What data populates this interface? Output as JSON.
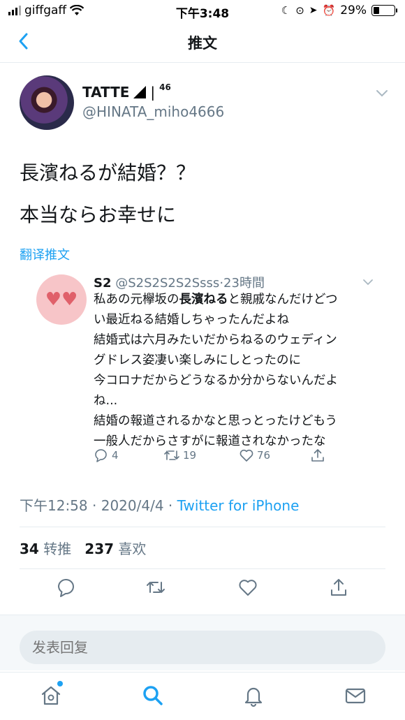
{
  "status_bar": {
    "carrier": "giffgaff",
    "time": "下午3:48",
    "battery": "29%",
    "battery_level": 0.29
  },
  "nav": {
    "title": "推文"
  },
  "tweet": {
    "author_name": "TATTE",
    "author_badge": "46",
    "author_handle": "@HINATA_miho4666",
    "lines": [
      "長濱ねるが結婚？？",
      "本当ならお幸せに"
    ],
    "translate_label": "翻译推文",
    "timestamp": "下午12:58",
    "date": "2020/4/4",
    "source": "Twitter for iPhone",
    "retweet_count": "34",
    "retweet_label": "转推",
    "like_count": "237",
    "like_label": "喜欢"
  },
  "quoted": {
    "name": "S2",
    "handle": "@S2S2S2S2Ssss",
    "time": "23時間",
    "line1_pre": "私あの元欅坂の",
    "line1_bold": "長濱ねる",
    "line1_post": "と親戚なんだけどつ",
    "lines": [
      "い最近ねる結婚しちゃったんだよね",
      "結婚式は六月みたいだからねるのウェディン",
      "グドレス姿凄い楽しみにしとったのに",
      "今コロナだからどうなるか分からないんだよ",
      "ね...",
      "結婚の報道されるかなと思っとったけどもう",
      "一般人だからさすがに報道されなかったな"
    ],
    "reply_count": "4",
    "retweet_count": "19",
    "like_count": "76"
  },
  "reply_box": {
    "placeholder": "发表回复"
  },
  "icons": {
    "accent": "#1da1f2",
    "gray": "#657786"
  }
}
